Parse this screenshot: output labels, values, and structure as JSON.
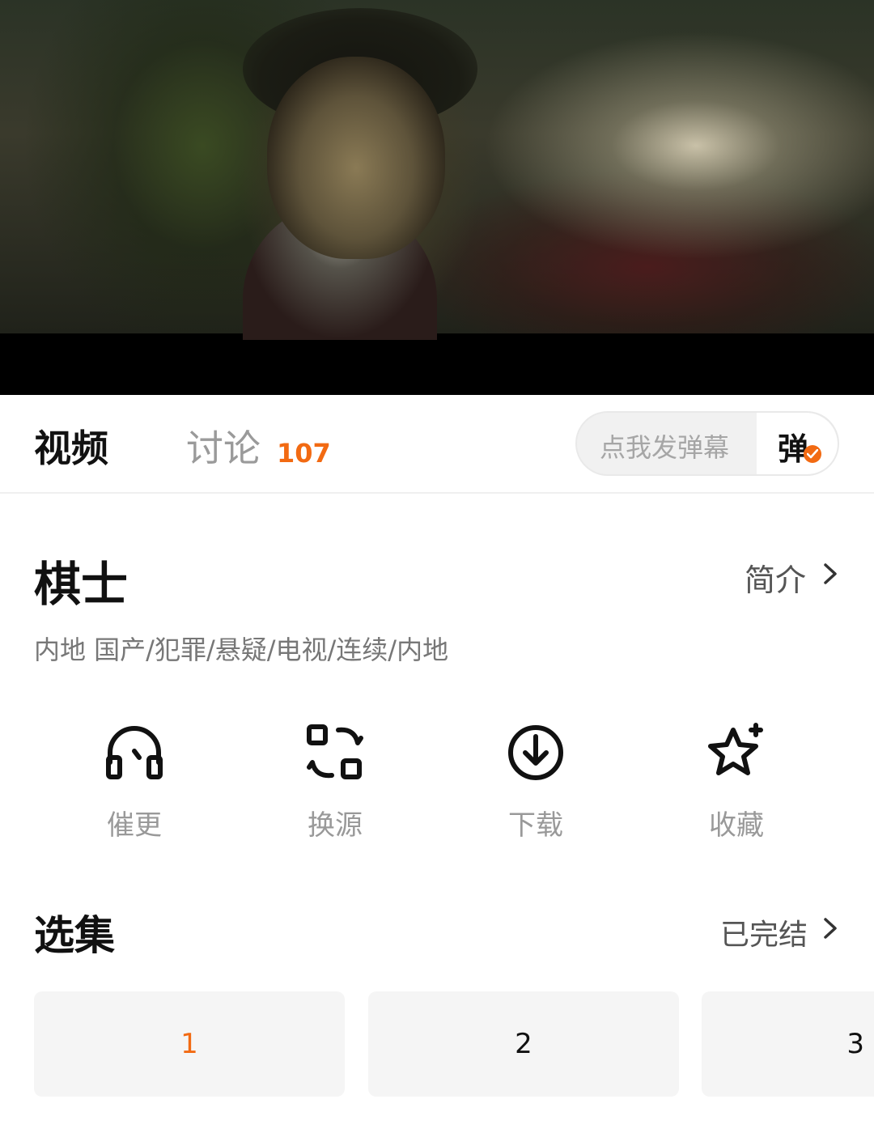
{
  "tabs": {
    "video_label": "视频",
    "discuss_label": "讨论",
    "discuss_count": "107"
  },
  "danmu": {
    "placeholder": "点我发弹幕",
    "toggle_char": "弹",
    "accent_color": "#f26a12"
  },
  "show": {
    "title": "棋士",
    "intro_label": "简介",
    "meta": "内地  国产/犯罪/悬疑/电视/连续/内地"
  },
  "actions": [
    {
      "label": "催更",
      "icon": "headphones-icon"
    },
    {
      "label": "换源",
      "icon": "switch-source-icon"
    },
    {
      "label": "下载",
      "icon": "download-icon"
    },
    {
      "label": "收藏",
      "icon": "star-icon"
    }
  ],
  "episodes": {
    "title": "选集",
    "status": "已完结",
    "items": [
      "1",
      "2",
      "3"
    ],
    "selected": "1"
  }
}
